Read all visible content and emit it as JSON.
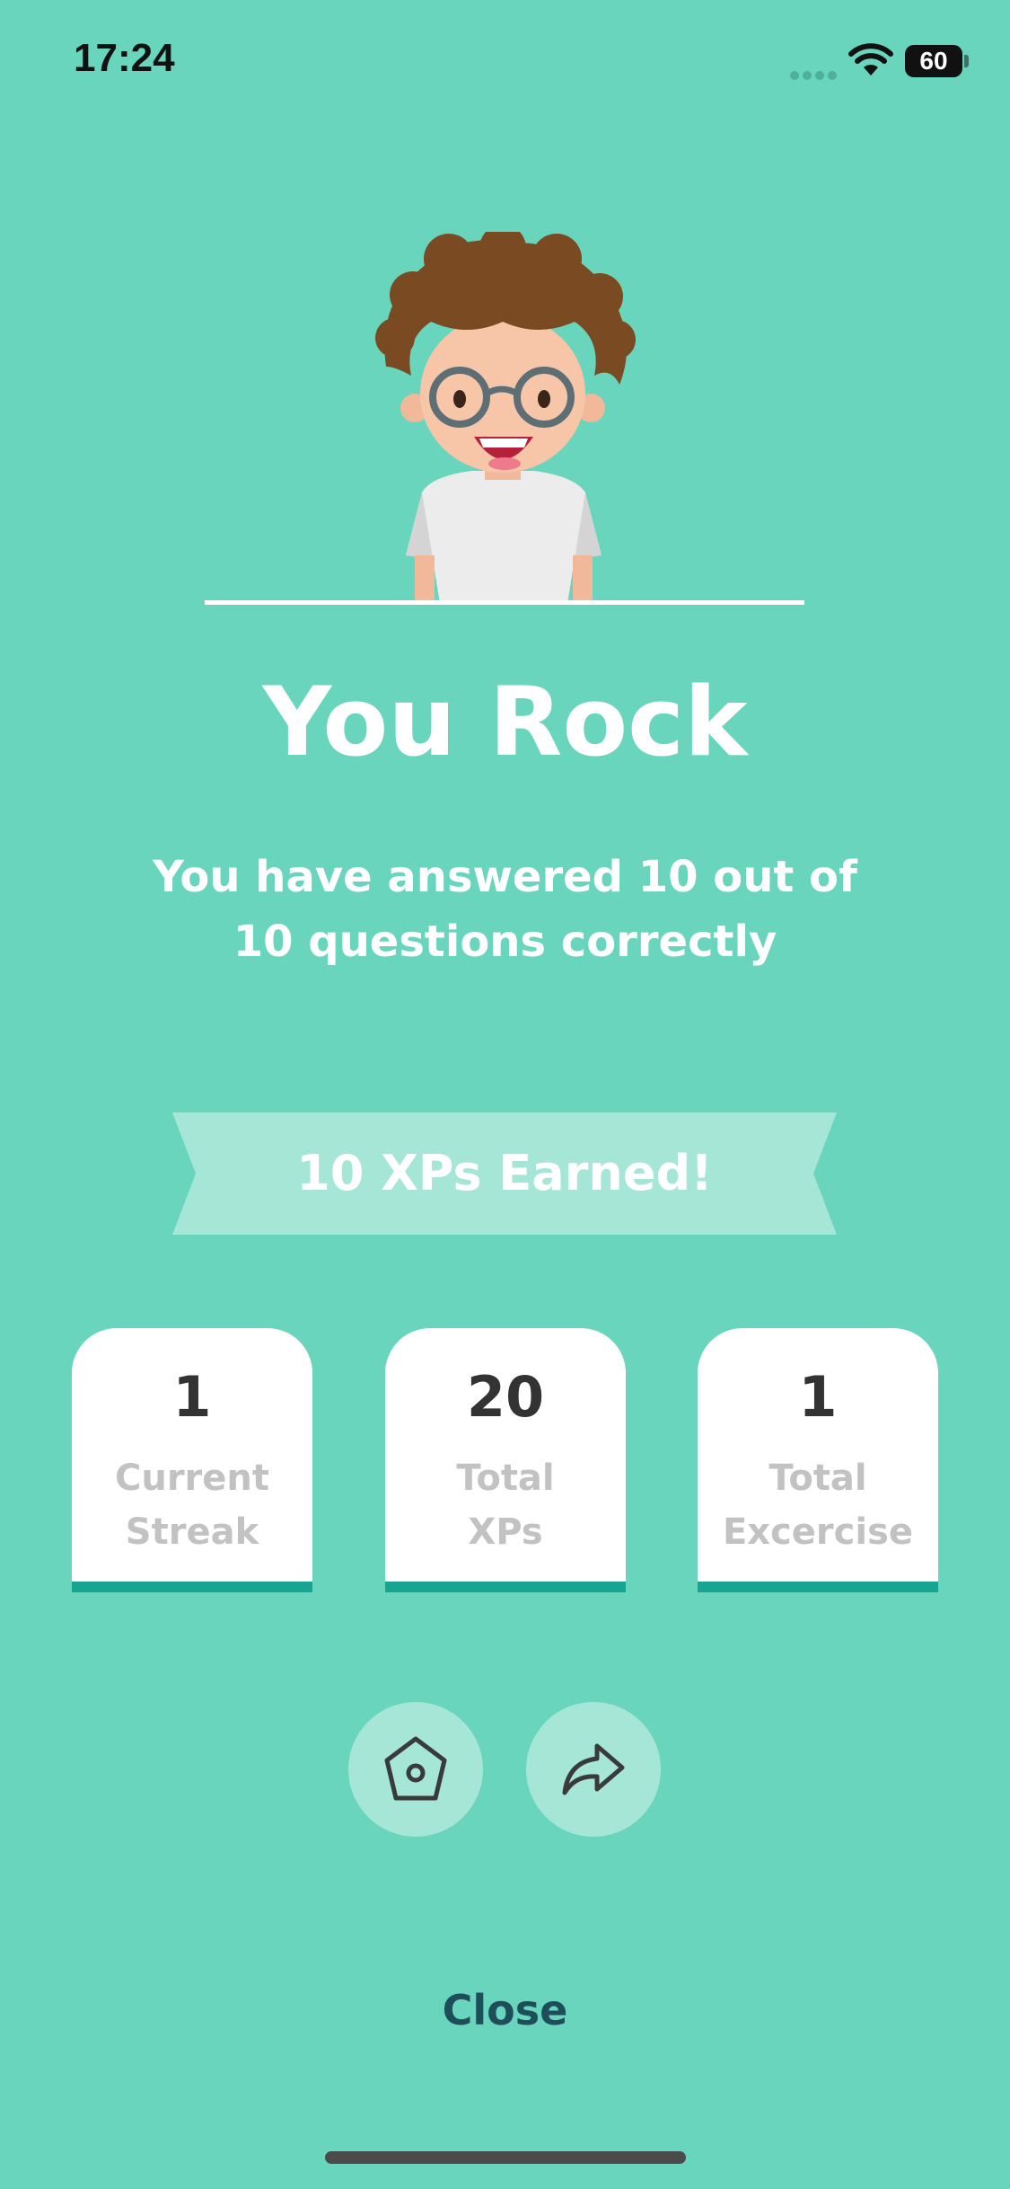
{
  "status_bar": {
    "time": "17:24",
    "battery_level": "60",
    "icons": [
      "signal-dots-icon",
      "wifi-icon",
      "battery-icon"
    ]
  },
  "result": {
    "title": "You Rock",
    "subtitle": "You have answered 10 out of 10 questions correctly",
    "xp_banner": "10 XPs Earned!"
  },
  "stats": [
    {
      "value": "1",
      "label": "Current\nStreak"
    },
    {
      "value": "20",
      "label": "Total\nXPs"
    },
    {
      "value": "1",
      "label": "Total\nExcercise"
    }
  ],
  "actions": {
    "home_icon": "home-icon",
    "share_icon": "share-icon",
    "close_label": "Close"
  },
  "colors": {
    "background": "#68d5bc",
    "accent": "#17a592",
    "ribbon": "#a5e6d7",
    "close_text": "#1d4e5a"
  }
}
